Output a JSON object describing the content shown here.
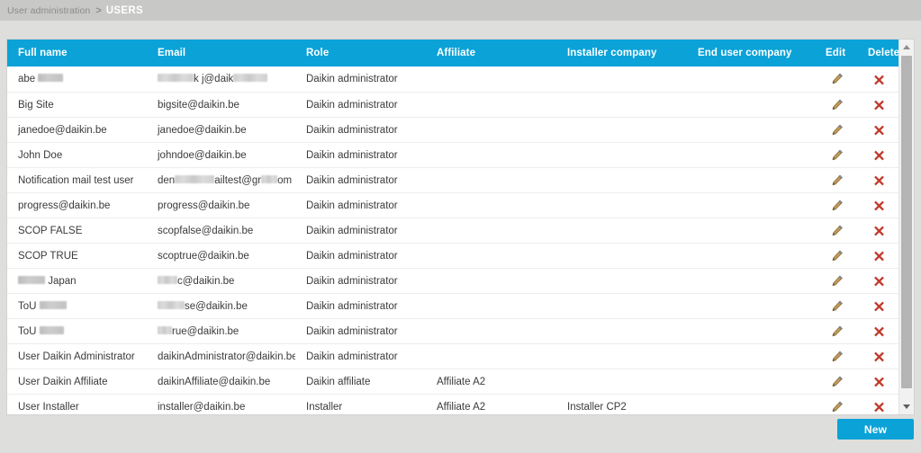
{
  "breadcrumb": {
    "parent": "User administration",
    "separator": ">",
    "current": "USERS"
  },
  "theme": {
    "accent": "#0ba2d7",
    "page_bg": "#dededc",
    "topbar_bg": "#c8c8c6",
    "panel_bg": "#ffffff",
    "row_border": "#ededed",
    "text": "#3a3a3a",
    "delete_icon": "#c0392b",
    "edit_icon": "#b08a4a"
  },
  "table": {
    "name": "users-table",
    "columns": [
      {
        "key": "full_name",
        "label": "Full name"
      },
      {
        "key": "email",
        "label": "Email"
      },
      {
        "key": "role",
        "label": "Role"
      },
      {
        "key": "affiliate",
        "label": "Affiliate"
      },
      {
        "key": "installer_company",
        "label": "Installer company"
      },
      {
        "key": "end_user_company",
        "label": "End user company"
      },
      {
        "key": "edit",
        "label": "Edit"
      },
      {
        "key": "delete",
        "label": "Delete"
      }
    ],
    "rows": [
      {
        "full_name": "abe ",
        "full_name_redacted": true,
        "full_name_redact_width": 28,
        "email": "",
        "email_redacted": true,
        "email_prefix_redact_width": 40,
        "email_mid": "k j@daik",
        "email_suffix_redact_width": 38,
        "role": "Daikin administrator",
        "affiliate": "",
        "installer_company": "",
        "end_user_company": ""
      },
      {
        "full_name": "Big Site",
        "email": "bigsite@daikin.be",
        "role": "Daikin administrator",
        "affiliate": "",
        "installer_company": "",
        "end_user_company": ""
      },
      {
        "full_name": "janedoe@daikin.be",
        "email": "janedoe@daikin.be",
        "role": "Daikin administrator",
        "affiliate": "",
        "installer_company": "",
        "end_user_company": ""
      },
      {
        "full_name": "John Doe",
        "email": "johndoe@daikin.be",
        "role": "Daikin administrator",
        "affiliate": "",
        "installer_company": "",
        "end_user_company": ""
      },
      {
        "full_name": "Notification mail test user",
        "email": "",
        "email_redacted": true,
        "email_lead": "den",
        "email_prefix_redact_width": 44,
        "email_mid": "ailtest@gr",
        "email_suffix_redact_width": 18,
        "email_tail": "om",
        "role": "Daikin administrator",
        "affiliate": "",
        "installer_company": "",
        "end_user_company": ""
      },
      {
        "full_name": "progress@daikin.be",
        "email": "progress@daikin.be",
        "role": "Daikin administrator",
        "affiliate": "",
        "installer_company": "",
        "end_user_company": ""
      },
      {
        "full_name": "SCOP FALSE",
        "email": "scopfalse@daikin.be",
        "role": "Daikin administrator",
        "affiliate": "",
        "installer_company": "",
        "end_user_company": ""
      },
      {
        "full_name": "SCOP TRUE",
        "email": "scoptrue@daikin.be",
        "role": "Daikin administrator",
        "affiliate": "",
        "installer_company": "",
        "end_user_company": ""
      },
      {
        "full_name": " Japan",
        "full_name_redacted": true,
        "full_name_lead_redact_width": 30,
        "full_name_tail": "Japan",
        "email": "",
        "email_redacted": true,
        "email_prefix_redact_width": 22,
        "email_mid": "c@daikin.be",
        "role": "Daikin administrator",
        "affiliate": "",
        "installer_company": "",
        "end_user_company": ""
      },
      {
        "full_name": "ToU ",
        "full_name_redacted": true,
        "full_name_redact_width": 30,
        "email": "",
        "email_redacted": true,
        "email_prefix_redact_width": 30,
        "email_mid": "se@daikin.be",
        "role": "Daikin administrator",
        "affiliate": "",
        "installer_company": "",
        "end_user_company": ""
      },
      {
        "full_name": "ToU ",
        "full_name_redacted": true,
        "full_name_redact_width": 27,
        "email": "",
        "email_redacted": true,
        "email_prefix_redact_width": 16,
        "email_mid": "rue@daikin.be",
        "role": "Daikin administrator",
        "affiliate": "",
        "installer_company": "",
        "end_user_company": ""
      },
      {
        "full_name": "User Daikin Administrator",
        "email": "daikinAdministrator@daikin.be",
        "role": "Daikin administrator",
        "affiliate": "",
        "installer_company": "",
        "end_user_company": ""
      },
      {
        "full_name": "User Daikin Affiliate",
        "email": "daikinAffiliate@daikin.be",
        "role": "Daikin affiliate",
        "affiliate": "Affiliate A2",
        "installer_company": "",
        "end_user_company": ""
      },
      {
        "full_name": "User Installer",
        "email": "installer@daikin.be",
        "role": "Installer",
        "affiliate": "Affiliate A2",
        "installer_company": "Installer CP2",
        "end_user_company": ""
      }
    ],
    "action_icons": {
      "edit": "pencil-icon",
      "delete": "cross-icon"
    }
  },
  "scrollbar": {
    "up_arrow": "triangle-up-icon",
    "down_arrow": "triangle-down-icon",
    "orientation": "vertical"
  },
  "footer": {
    "new_button": "New"
  }
}
